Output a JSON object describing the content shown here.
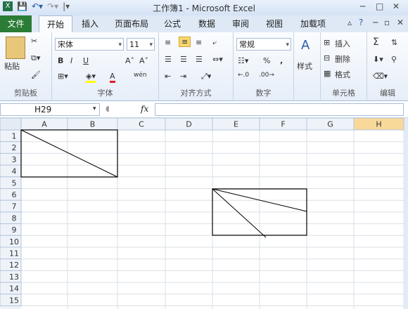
{
  "title": "工作簿1 - Microsoft Excel",
  "tabs": {
    "file": "文件",
    "items": [
      "开始",
      "插入",
      "页面布局",
      "公式",
      "数据",
      "审阅",
      "视图",
      "加载项"
    ]
  },
  "ribbon": {
    "clipboard": {
      "label": "剪贴板",
      "paste": "粘贴"
    },
    "font": {
      "label": "字体",
      "name": "宋体",
      "size": "11",
      "bold": "B",
      "italic": "I",
      "underline": "U",
      "font_color_glyph": "A",
      "phonetic": "wén"
    },
    "alignment": {
      "label": "对齐方式"
    },
    "number": {
      "label": "数字",
      "format": "常规",
      "percent": "%",
      "comma": ","
    },
    "styles": {
      "label": "样式",
      "button": "样式"
    },
    "cells": {
      "label": "单元格",
      "insert": "插入",
      "delete": "删除",
      "format": "格式"
    },
    "editing": {
      "label": "编辑",
      "sum": "Σ"
    }
  },
  "formula_bar": {
    "name_box": "H29",
    "fx": "fx",
    "value": ""
  },
  "sheet": {
    "columns": [
      "A",
      "B",
      "C",
      "D",
      "E",
      "F",
      "G",
      "H"
    ],
    "rows": [
      "1",
      "2",
      "3",
      "4",
      "5",
      "6",
      "7",
      "8",
      "9",
      "10",
      "11",
      "12",
      "13",
      "14",
      "15"
    ],
    "selected_column": "H"
  }
}
